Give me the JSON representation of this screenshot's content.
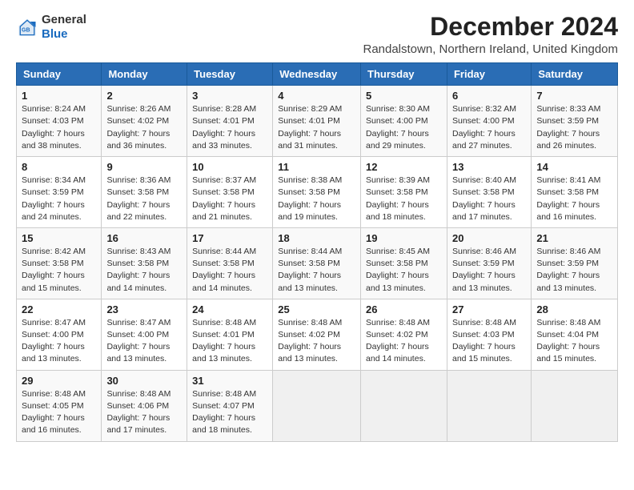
{
  "logo": {
    "general": "General",
    "blue": "Blue"
  },
  "title": "December 2024",
  "subtitle": "Randalstown, Northern Ireland, United Kingdom",
  "days_of_week": [
    "Sunday",
    "Monday",
    "Tuesday",
    "Wednesday",
    "Thursday",
    "Friday",
    "Saturday"
  ],
  "weeks": [
    [
      {
        "day": "1",
        "sunrise": "8:24 AM",
        "sunset": "4:03 PM",
        "daylight": "7 hours and 38 minutes."
      },
      {
        "day": "2",
        "sunrise": "8:26 AM",
        "sunset": "4:02 PM",
        "daylight": "7 hours and 36 minutes."
      },
      {
        "day": "3",
        "sunrise": "8:28 AM",
        "sunset": "4:01 PM",
        "daylight": "7 hours and 33 minutes."
      },
      {
        "day": "4",
        "sunrise": "8:29 AM",
        "sunset": "4:01 PM",
        "daylight": "7 hours and 31 minutes."
      },
      {
        "day": "5",
        "sunrise": "8:30 AM",
        "sunset": "4:00 PM",
        "daylight": "7 hours and 29 minutes."
      },
      {
        "day": "6",
        "sunrise": "8:32 AM",
        "sunset": "4:00 PM",
        "daylight": "7 hours and 27 minutes."
      },
      {
        "day": "7",
        "sunrise": "8:33 AM",
        "sunset": "3:59 PM",
        "daylight": "7 hours and 26 minutes."
      }
    ],
    [
      {
        "day": "8",
        "sunrise": "8:34 AM",
        "sunset": "3:59 PM",
        "daylight": "7 hours and 24 minutes."
      },
      {
        "day": "9",
        "sunrise": "8:36 AM",
        "sunset": "3:58 PM",
        "daylight": "7 hours and 22 minutes."
      },
      {
        "day": "10",
        "sunrise": "8:37 AM",
        "sunset": "3:58 PM",
        "daylight": "7 hours and 21 minutes."
      },
      {
        "day": "11",
        "sunrise": "8:38 AM",
        "sunset": "3:58 PM",
        "daylight": "7 hours and 19 minutes."
      },
      {
        "day": "12",
        "sunrise": "8:39 AM",
        "sunset": "3:58 PM",
        "daylight": "7 hours and 18 minutes."
      },
      {
        "day": "13",
        "sunrise": "8:40 AM",
        "sunset": "3:58 PM",
        "daylight": "7 hours and 17 minutes."
      },
      {
        "day": "14",
        "sunrise": "8:41 AM",
        "sunset": "3:58 PM",
        "daylight": "7 hours and 16 minutes."
      }
    ],
    [
      {
        "day": "15",
        "sunrise": "8:42 AM",
        "sunset": "3:58 PM",
        "daylight": "7 hours and 15 minutes."
      },
      {
        "day": "16",
        "sunrise": "8:43 AM",
        "sunset": "3:58 PM",
        "daylight": "7 hours and 14 minutes."
      },
      {
        "day": "17",
        "sunrise": "8:44 AM",
        "sunset": "3:58 PM",
        "daylight": "7 hours and 14 minutes."
      },
      {
        "day": "18",
        "sunrise": "8:44 AM",
        "sunset": "3:58 PM",
        "daylight": "7 hours and 13 minutes."
      },
      {
        "day": "19",
        "sunrise": "8:45 AM",
        "sunset": "3:58 PM",
        "daylight": "7 hours and 13 minutes."
      },
      {
        "day": "20",
        "sunrise": "8:46 AM",
        "sunset": "3:59 PM",
        "daylight": "7 hours and 13 minutes."
      },
      {
        "day": "21",
        "sunrise": "8:46 AM",
        "sunset": "3:59 PM",
        "daylight": "7 hours and 13 minutes."
      }
    ],
    [
      {
        "day": "22",
        "sunrise": "8:47 AM",
        "sunset": "4:00 PM",
        "daylight": "7 hours and 13 minutes."
      },
      {
        "day": "23",
        "sunrise": "8:47 AM",
        "sunset": "4:00 PM",
        "daylight": "7 hours and 13 minutes."
      },
      {
        "day": "24",
        "sunrise": "8:48 AM",
        "sunset": "4:01 PM",
        "daylight": "7 hours and 13 minutes."
      },
      {
        "day": "25",
        "sunrise": "8:48 AM",
        "sunset": "4:02 PM",
        "daylight": "7 hours and 13 minutes."
      },
      {
        "day": "26",
        "sunrise": "8:48 AM",
        "sunset": "4:02 PM",
        "daylight": "7 hours and 14 minutes."
      },
      {
        "day": "27",
        "sunrise": "8:48 AM",
        "sunset": "4:03 PM",
        "daylight": "7 hours and 15 minutes."
      },
      {
        "day": "28",
        "sunrise": "8:48 AM",
        "sunset": "4:04 PM",
        "daylight": "7 hours and 15 minutes."
      }
    ],
    [
      {
        "day": "29",
        "sunrise": "8:48 AM",
        "sunset": "4:05 PM",
        "daylight": "7 hours and 16 minutes."
      },
      {
        "day": "30",
        "sunrise": "8:48 AM",
        "sunset": "4:06 PM",
        "daylight": "7 hours and 17 minutes."
      },
      {
        "day": "31",
        "sunrise": "8:48 AM",
        "sunset": "4:07 PM",
        "daylight": "7 hours and 18 minutes."
      },
      null,
      null,
      null,
      null
    ]
  ],
  "labels": {
    "sunrise": "Sunrise:",
    "sunset": "Sunset:",
    "daylight": "Daylight:"
  }
}
